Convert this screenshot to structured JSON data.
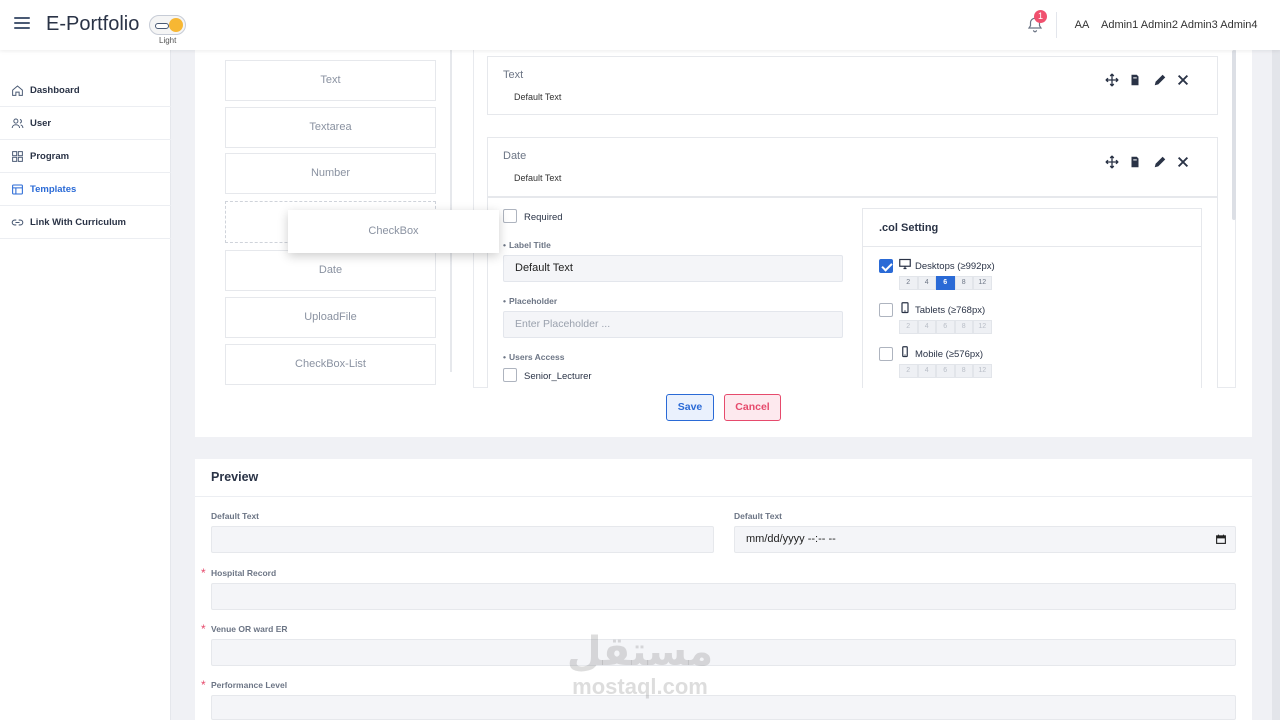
{
  "header": {
    "app_title": "E-Portfolio",
    "theme_label": "Light",
    "notification_count": "1",
    "avatar_initials": "AA",
    "user_name": "Admin1 Admin2 Admin3 Admin4"
  },
  "sidebar": {
    "items": [
      {
        "label": "Dashboard",
        "icon": "home-icon"
      },
      {
        "label": "User",
        "icon": "users-icon"
      },
      {
        "label": "Program",
        "icon": "grid-icon"
      },
      {
        "label": "Templates",
        "icon": "template-icon",
        "active": true
      },
      {
        "label": "Link With Curriculum",
        "icon": "link-icon"
      }
    ]
  },
  "palette": {
    "items": [
      "Text",
      "Textarea",
      "Number",
      "Date",
      "UploadFile",
      "CheckBox-List"
    ],
    "dragging": "CheckBox"
  },
  "canvas": {
    "fields": [
      {
        "type": "Text",
        "label": "Default Text"
      },
      {
        "type": "Date",
        "label": "Default Text"
      }
    ],
    "editor": {
      "required_label": "Required",
      "label_title_label": "Label Title",
      "label_title_value": "Default Text",
      "placeholder_label": "Placeholder",
      "placeholder_hint": "Enter Placeholder ...",
      "users_access_label": "Users Access",
      "users_access_options": [
        "Senior_Lecturer"
      ]
    },
    "col_setting": {
      "title": ".col Setting",
      "sizes": [
        "2",
        "4",
        "6",
        "8",
        "12"
      ],
      "devices": [
        {
          "label": "Desktops (≥992px)",
          "icon": "monitor-icon",
          "checked": true,
          "active_size": "6"
        },
        {
          "label": "Tablets (≥768px)",
          "icon": "tablet-icon",
          "checked": false
        },
        {
          "label": "Mobile (≥576px)",
          "icon": "phone-icon",
          "checked": false
        }
      ]
    },
    "save_label": "Save",
    "cancel_label": "Cancel"
  },
  "preview": {
    "title": "Preview",
    "fields": [
      {
        "label": "Default Text",
        "required": false
      },
      {
        "label": "Default Text",
        "required": false,
        "value": "mm/dd/yyyy --:-- --"
      },
      {
        "label": "Hospital Record",
        "required": true
      },
      {
        "label": "Venue OR ward ER",
        "required": true
      },
      {
        "label": "Performance Level",
        "required": true
      }
    ]
  },
  "watermark": {
    "arabic": "مستقل",
    "latin": "mostaql.com"
  },
  "colors": {
    "accent": "#2a6ad6",
    "danger": "#e64a6c",
    "badge": "#f0506e"
  }
}
